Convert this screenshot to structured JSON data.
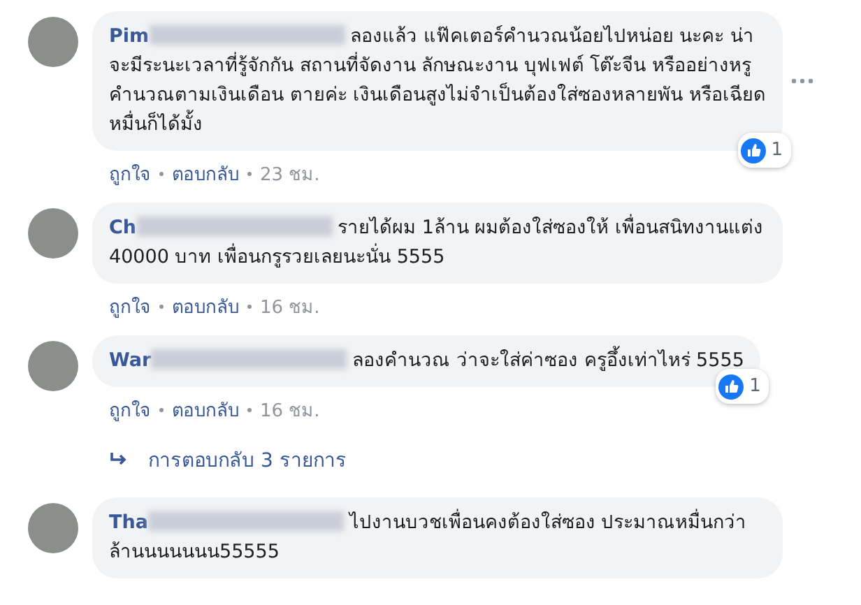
{
  "comments": [
    {
      "name": "Pim",
      "text": "ลองแล้ว แฟ๊คเตอร์คำนวณน้อยไปหน่อย นะคะ น่าจะมีระนะเวลาที่รู้จักกัน สถานที่จัดงาน ลักษณะงาน บุฟเฟต์ โต๊ะจีน หรืออย่างหรู คำนวณตามเงินเดือน ตายค่ะ เงินเดือนสูงไม่จำเป็นต้องใส่ซองหลายพัน หรือเฉียดหมื่นก็ได้มั้ง",
      "reactions": "1",
      "show_options": true,
      "actions": [
        "ถูกใจ",
        "ตอบกลับ",
        "23 ชม."
      ]
    },
    {
      "name": "Ch",
      "text": "รายได้ผม 1ล้าน ผมต้องใส่ซองให้ เพื่อนสนิทงานแต่ง 40000 บาท เพื่อนกรูรวยเลยนะนั่น 5555",
      "show_options": false,
      "actions": [
        "ถูกใจ",
        "ตอบกลับ",
        "16 ชม."
      ]
    },
    {
      "name": "War",
      "text": "ลองคำนวณ ว่าจะใส่ค่าซอง ครูอึ้งเท่าไหร่ 5555",
      "reactions": "1",
      "show_options": false,
      "actions": [
        "ถูกใจ",
        "ตอบกลับ",
        "16 ชม."
      ],
      "replies_link": "การตอบกลับ 3 รายการ"
    },
    {
      "name": "Tha",
      "text": "ไปงานบวชเพื่อนคงต้องใส่ซอง ประมาณหมื่นกว่าล้านนนนนนน55555",
      "show_options": false
    }
  ]
}
